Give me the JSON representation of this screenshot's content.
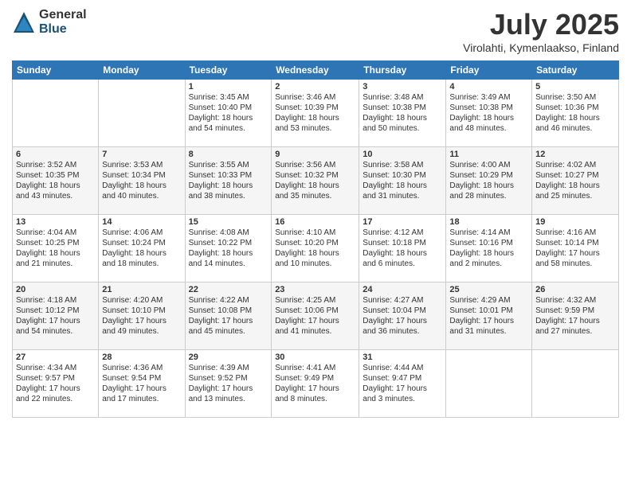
{
  "header": {
    "logo_general": "General",
    "logo_blue": "Blue",
    "title": "July 2025",
    "location": "Virolahti, Kymenlaakso, Finland"
  },
  "weekdays": [
    "Sunday",
    "Monday",
    "Tuesday",
    "Wednesday",
    "Thursday",
    "Friday",
    "Saturday"
  ],
  "weeks": [
    [
      {
        "day": "",
        "info": ""
      },
      {
        "day": "",
        "info": ""
      },
      {
        "day": "1",
        "info": "Sunrise: 3:45 AM\nSunset: 10:40 PM\nDaylight: 18 hours\nand 54 minutes."
      },
      {
        "day": "2",
        "info": "Sunrise: 3:46 AM\nSunset: 10:39 PM\nDaylight: 18 hours\nand 53 minutes."
      },
      {
        "day": "3",
        "info": "Sunrise: 3:48 AM\nSunset: 10:38 PM\nDaylight: 18 hours\nand 50 minutes."
      },
      {
        "day": "4",
        "info": "Sunrise: 3:49 AM\nSunset: 10:38 PM\nDaylight: 18 hours\nand 48 minutes."
      },
      {
        "day": "5",
        "info": "Sunrise: 3:50 AM\nSunset: 10:36 PM\nDaylight: 18 hours\nand 46 minutes."
      }
    ],
    [
      {
        "day": "6",
        "info": "Sunrise: 3:52 AM\nSunset: 10:35 PM\nDaylight: 18 hours\nand 43 minutes."
      },
      {
        "day": "7",
        "info": "Sunrise: 3:53 AM\nSunset: 10:34 PM\nDaylight: 18 hours\nand 40 minutes."
      },
      {
        "day": "8",
        "info": "Sunrise: 3:55 AM\nSunset: 10:33 PM\nDaylight: 18 hours\nand 38 minutes."
      },
      {
        "day": "9",
        "info": "Sunrise: 3:56 AM\nSunset: 10:32 PM\nDaylight: 18 hours\nand 35 minutes."
      },
      {
        "day": "10",
        "info": "Sunrise: 3:58 AM\nSunset: 10:30 PM\nDaylight: 18 hours\nand 31 minutes."
      },
      {
        "day": "11",
        "info": "Sunrise: 4:00 AM\nSunset: 10:29 PM\nDaylight: 18 hours\nand 28 minutes."
      },
      {
        "day": "12",
        "info": "Sunrise: 4:02 AM\nSunset: 10:27 PM\nDaylight: 18 hours\nand 25 minutes."
      }
    ],
    [
      {
        "day": "13",
        "info": "Sunrise: 4:04 AM\nSunset: 10:25 PM\nDaylight: 18 hours\nand 21 minutes."
      },
      {
        "day": "14",
        "info": "Sunrise: 4:06 AM\nSunset: 10:24 PM\nDaylight: 18 hours\nand 18 minutes."
      },
      {
        "day": "15",
        "info": "Sunrise: 4:08 AM\nSunset: 10:22 PM\nDaylight: 18 hours\nand 14 minutes."
      },
      {
        "day": "16",
        "info": "Sunrise: 4:10 AM\nSunset: 10:20 PM\nDaylight: 18 hours\nand 10 minutes."
      },
      {
        "day": "17",
        "info": "Sunrise: 4:12 AM\nSunset: 10:18 PM\nDaylight: 18 hours\nand 6 minutes."
      },
      {
        "day": "18",
        "info": "Sunrise: 4:14 AM\nSunset: 10:16 PM\nDaylight: 18 hours\nand 2 minutes."
      },
      {
        "day": "19",
        "info": "Sunrise: 4:16 AM\nSunset: 10:14 PM\nDaylight: 17 hours\nand 58 minutes."
      }
    ],
    [
      {
        "day": "20",
        "info": "Sunrise: 4:18 AM\nSunset: 10:12 PM\nDaylight: 17 hours\nand 54 minutes."
      },
      {
        "day": "21",
        "info": "Sunrise: 4:20 AM\nSunset: 10:10 PM\nDaylight: 17 hours\nand 49 minutes."
      },
      {
        "day": "22",
        "info": "Sunrise: 4:22 AM\nSunset: 10:08 PM\nDaylight: 17 hours\nand 45 minutes."
      },
      {
        "day": "23",
        "info": "Sunrise: 4:25 AM\nSunset: 10:06 PM\nDaylight: 17 hours\nand 41 minutes."
      },
      {
        "day": "24",
        "info": "Sunrise: 4:27 AM\nSunset: 10:04 PM\nDaylight: 17 hours\nand 36 minutes."
      },
      {
        "day": "25",
        "info": "Sunrise: 4:29 AM\nSunset: 10:01 PM\nDaylight: 17 hours\nand 31 minutes."
      },
      {
        "day": "26",
        "info": "Sunrise: 4:32 AM\nSunset: 9:59 PM\nDaylight: 17 hours\nand 27 minutes."
      }
    ],
    [
      {
        "day": "27",
        "info": "Sunrise: 4:34 AM\nSunset: 9:57 PM\nDaylight: 17 hours\nand 22 minutes."
      },
      {
        "day": "28",
        "info": "Sunrise: 4:36 AM\nSunset: 9:54 PM\nDaylight: 17 hours\nand 17 minutes."
      },
      {
        "day": "29",
        "info": "Sunrise: 4:39 AM\nSunset: 9:52 PM\nDaylight: 17 hours\nand 13 minutes."
      },
      {
        "day": "30",
        "info": "Sunrise: 4:41 AM\nSunset: 9:49 PM\nDaylight: 17 hours\nand 8 minutes."
      },
      {
        "day": "31",
        "info": "Sunrise: 4:44 AM\nSunset: 9:47 PM\nDaylight: 17 hours\nand 3 minutes."
      },
      {
        "day": "",
        "info": ""
      },
      {
        "day": "",
        "info": ""
      }
    ]
  ]
}
